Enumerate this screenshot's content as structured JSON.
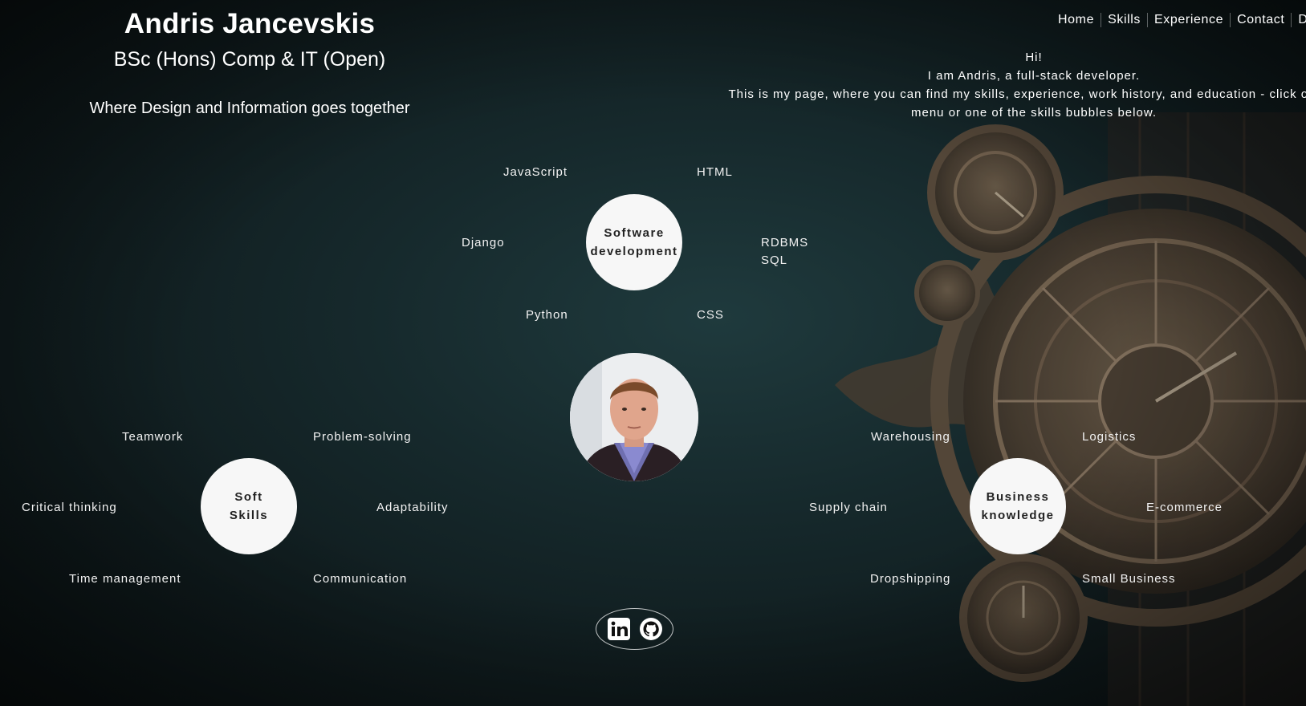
{
  "header": {
    "name": "Andris Jancevskis",
    "degree": "BSc (Hons) Comp & IT (Open)",
    "tagline": "Where Design and Information goes together"
  },
  "nav": {
    "items": [
      "Home",
      "Skills",
      "Experience",
      "Contact",
      "D"
    ]
  },
  "intro": {
    "line1": "Hi!",
    "line2": "I am Andris, a full-stack developer.",
    "line3": "This is my page, where you can find my skills, experience, work history, and education - click on the menu or one of the skills bubbles below."
  },
  "software": {
    "title_line1": "Software",
    "title_line2": "development",
    "skills": [
      "JavaScript",
      "HTML",
      "Django",
      "RDBMS",
      "SQL",
      "Python",
      "CSS"
    ]
  },
  "soft": {
    "title_line1": "Soft",
    "title_line2": "Skills",
    "skills": [
      "Teamwork",
      "Problem-solving",
      "Critical thinking",
      "Adaptability",
      "Time management",
      "Communication"
    ]
  },
  "business": {
    "title_line1": "Business",
    "title_line2": "knowledge",
    "skills": [
      "Warehousing",
      "Logistics",
      "Supply chain",
      "E-commerce",
      "Dropshipping",
      "Small Business"
    ]
  },
  "social": {
    "icons": [
      "linkedin-icon",
      "github-icon"
    ]
  },
  "colors": {
    "bubble": "#f7f7f7",
    "background": "#16292c",
    "text": "#ffffff"
  }
}
